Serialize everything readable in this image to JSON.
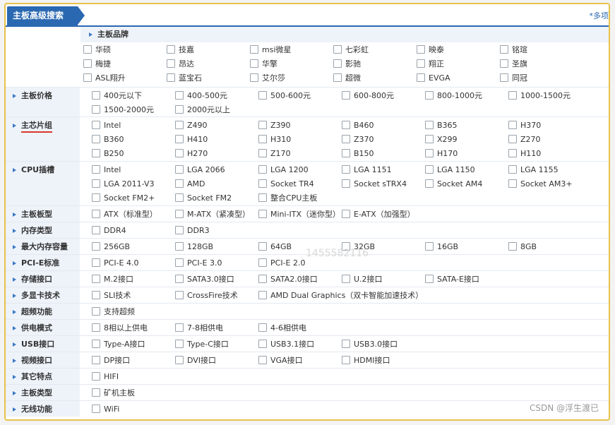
{
  "header": {
    "title": "主板高级搜索",
    "multi_note": "*多项"
  },
  "brand": {
    "label": "主板品牌",
    "options": [
      [
        "华硕",
        "技嘉",
        "msi微星",
        "七彩虹",
        "映泰",
        "铭瑄"
      ],
      [
        "梅捷",
        "昂达",
        "华擎",
        "影驰",
        "翔正",
        "圣旗"
      ],
      [
        "ASL翔升",
        "蓝宝石",
        "艾尔莎",
        "超微",
        "EVGA",
        "同冠"
      ]
    ]
  },
  "sections": [
    {
      "label": "主板价格",
      "rows": [
        [
          "400元以下",
          "400-500元",
          "500-600元",
          "600-800元",
          "800-1000元",
          "1000-1500元"
        ],
        [
          "1500-2000元",
          "2000元以上"
        ]
      ]
    },
    {
      "label": "主芯片组",
      "highlight": true,
      "rows": [
        [
          "Intel",
          "Z490",
          "Z390",
          "B460",
          "B365",
          "H370"
        ],
        [
          "B360",
          "H410",
          "H310",
          "Z370",
          "X299",
          "Z270"
        ],
        [
          "B250",
          "H270",
          "Z170",
          "B150",
          "H170",
          "H110"
        ]
      ]
    },
    {
      "label": "CPU插槽",
      "rows": [
        [
          "Intel",
          "LGA 2066",
          "LGA 1200",
          "LGA 1151",
          "LGA 1150",
          "LGA 1155"
        ],
        [
          "LGA 2011-V3",
          "AMD",
          "Socket TR4",
          "Socket sTRX4",
          "Socket AM4",
          "Socket AM3+"
        ],
        [
          "Socket FM2+",
          "Socket FM2",
          "整合CPU主板"
        ]
      ]
    },
    {
      "label": "主板板型",
      "rows": [
        [
          "ATX（标准型）",
          "M-ATX（紧凑型）",
          "Mini-ITX（迷你型）",
          "E-ATX（加强型）"
        ]
      ]
    },
    {
      "label": "内存类型",
      "rows": [
        [
          "DDR4",
          "DDR3"
        ]
      ]
    },
    {
      "label": "最大内存容量",
      "rows": [
        [
          "256GB",
          "128GB",
          "64GB",
          "32GB",
          "16GB",
          "8GB"
        ]
      ]
    },
    {
      "label": "PCI-E标准",
      "rows": [
        [
          "PCI-E 4.0",
          "PCI-E 3.0",
          "PCI-E 2.0"
        ]
      ]
    },
    {
      "label": "存储接口",
      "rows": [
        [
          "M.2接口",
          "SATA3.0接口",
          "SATA2.0接口",
          "U.2接口",
          "SATA-E接口"
        ]
      ]
    },
    {
      "label": "多显卡技术",
      "rows": [
        [
          "SLI技术",
          "CrossFire技术",
          "AMD Dual Graphics（双卡智能加速技术）"
        ]
      ]
    },
    {
      "label": "超频功能",
      "rows": [
        [
          "支持超频"
        ]
      ]
    },
    {
      "label": "供电模式",
      "rows": [
        [
          "8相以上供电",
          "7-8相供电",
          "4-6相供电"
        ]
      ]
    },
    {
      "label": "USB接口",
      "rows": [
        [
          "Type-A接口",
          "Type-C接口",
          "USB3.1接口",
          "USB3.0接口"
        ]
      ]
    },
    {
      "label": "视频接口",
      "rows": [
        [
          "DP接口",
          "DVI接口",
          "VGA接口",
          "HDMI接口"
        ]
      ]
    },
    {
      "label": "其它特点",
      "rows": [
        [
          "HIFI"
        ]
      ]
    },
    {
      "label": "主板类型",
      "rows": [
        [
          "矿机主板"
        ]
      ]
    },
    {
      "label": "无线功能",
      "rows": [
        [
          "WiFi"
        ]
      ]
    }
  ],
  "watermark_number": "1455582116",
  "watermark_credit": "CSDN @浮生渡已",
  "colors": {
    "accent": "#2a68b1",
    "label_bg": "#eef3fa",
    "frame": "#e7c24c",
    "highlight_underline": "#d9362a"
  }
}
